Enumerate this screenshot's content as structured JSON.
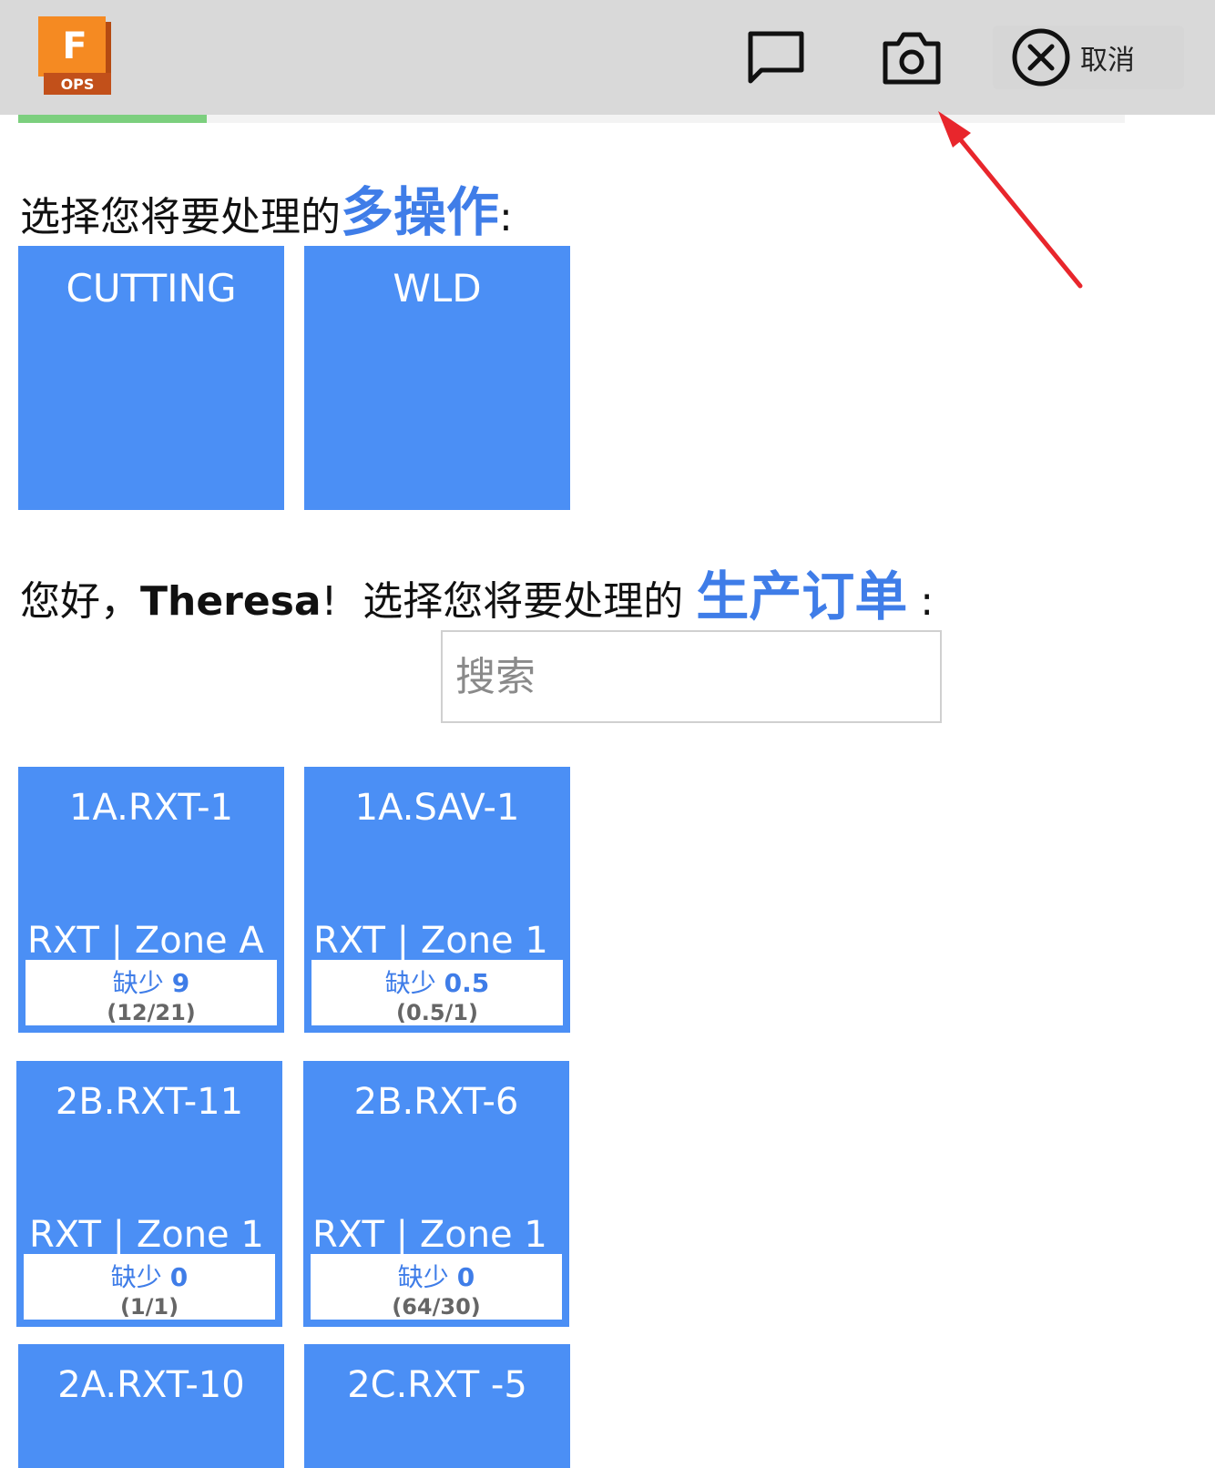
{
  "app": {
    "logo_letter": "F",
    "logo_text": "OPS"
  },
  "toolbar": {
    "chat_icon": "message-square-icon",
    "camera_icon": "camera-icon",
    "cancel_icon": "circle-x-icon",
    "cancel_label": "取消"
  },
  "progress": {
    "fraction": 0.17,
    "color": "#7ccf7e"
  },
  "operations": {
    "heading_prefix": "选择您将要处理的",
    "heading_accent": "多操作",
    "heading_suffix": ":",
    "items": [
      {
        "label": "CUTTING"
      },
      {
        "label": "WLD"
      }
    ]
  },
  "orders": {
    "greeting": "您好，",
    "user_name": "Theresa",
    "greeting_end": "!",
    "heading_prefix": "选择您将要处理的",
    "heading_accent": "生产订单",
    "heading_suffix": ":",
    "search_placeholder": "搜索",
    "short_label": "缺少",
    "items": [
      {
        "title": "1A.RXT-1",
        "zone": "RXT | Zone A",
        "short": "9",
        "ratio": "(12/21)"
      },
      {
        "title": "1A.SAV-1",
        "zone": "RXT | Zone 1",
        "short": "0.5",
        "ratio": "(0.5/1)"
      },
      {
        "title": "2B.RXT-11",
        "zone": "RXT | Zone 1",
        "short": "0",
        "ratio": "(1/1)"
      },
      {
        "title": "2B.RXT-6",
        "zone": "RXT | Zone 1",
        "short": "0",
        "ratio": "(64/30)"
      },
      {
        "title": "2A.RXT-10"
      },
      {
        "title": "2C.RXT -5"
      }
    ]
  },
  "colors": {
    "tile": "#4b8ff5",
    "accent": "#3f7de8",
    "topbar": "#d9d9d9",
    "annotation_arrow": "#e8262c"
  }
}
